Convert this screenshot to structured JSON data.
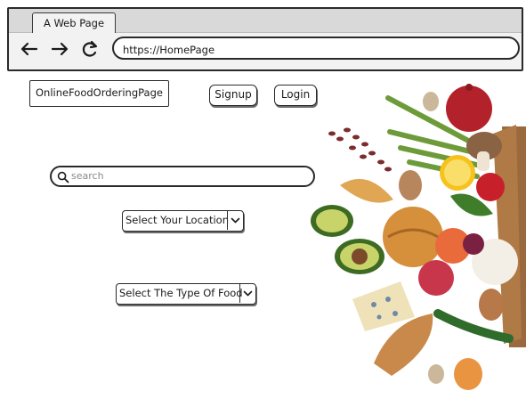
{
  "browser": {
    "tab_title": "A Web Page",
    "url": "https://HomePage",
    "back_icon": "arrow-left-icon",
    "forward_icon": "arrow-right-icon",
    "reload_icon": "reload-icon"
  },
  "page": {
    "brand": "OnlineFoodOrderingPage",
    "signup_label": "Signup",
    "login_label": "Login",
    "search_placeholder": "search",
    "location_select": "Select Your Location",
    "food_type_select": "Select The Type Of Food"
  },
  "illustration": {
    "icon": "groceries-image"
  }
}
